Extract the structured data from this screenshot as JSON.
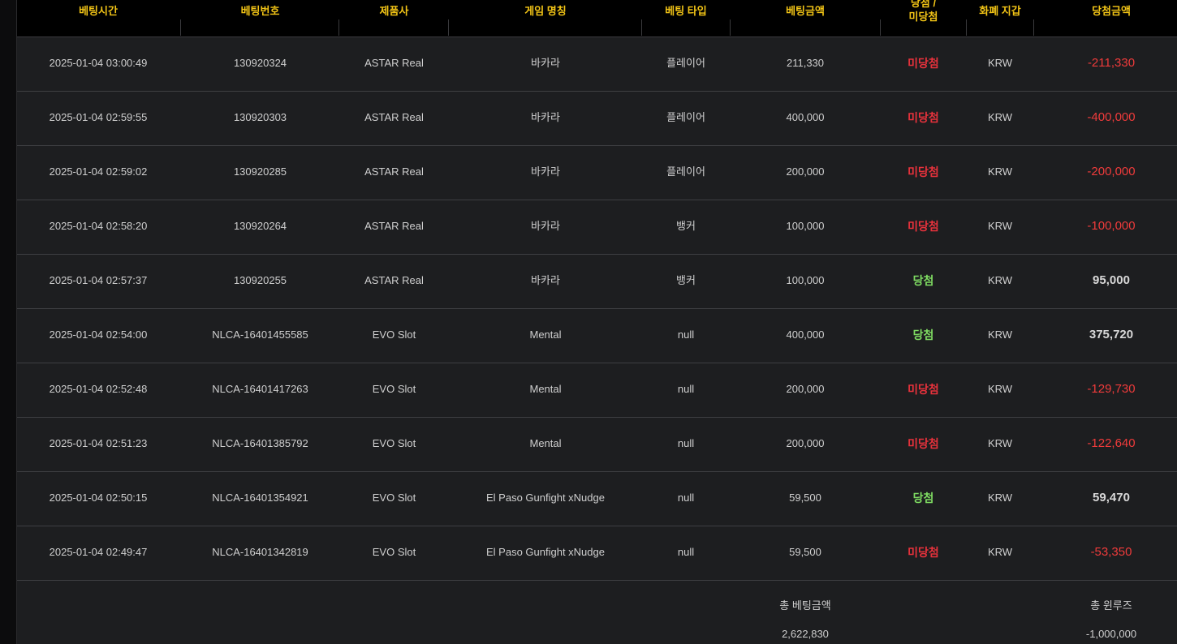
{
  "headers": {
    "bet_time": "베팅시간",
    "bet_no": "베팅번호",
    "vendor": "제품사",
    "game_name": "게임 명칭",
    "bet_type": "베팅 타입",
    "bet_amount": "베팅금액",
    "result_line1": "당첨 /",
    "result_line2": "미당첨",
    "currency": "화폐 지갑",
    "win_amount": "당첨금액"
  },
  "rows": [
    {
      "time": "2025-01-04 03:00:49",
      "bet_no": "130920324",
      "vendor": "ASTAR Real",
      "game": "바카라",
      "type": "플레이어",
      "amount": "211,330",
      "result": "미당첨",
      "currency": "KRW",
      "win_amount": "-211,330"
    },
    {
      "time": "2025-01-04 02:59:55",
      "bet_no": "130920303",
      "vendor": "ASTAR Real",
      "game": "바카라",
      "type": "플레이어",
      "amount": "400,000",
      "result": "미당첨",
      "currency": "KRW",
      "win_amount": "-400,000"
    },
    {
      "time": "2025-01-04 02:59:02",
      "bet_no": "130920285",
      "vendor": "ASTAR Real",
      "game": "바카라",
      "type": "플레이어",
      "amount": "200,000",
      "result": "미당첨",
      "currency": "KRW",
      "win_amount": "-200,000"
    },
    {
      "time": "2025-01-04 02:58:20",
      "bet_no": "130920264",
      "vendor": "ASTAR Real",
      "game": "바카라",
      "type": "뱅커",
      "amount": "100,000",
      "result": "미당첨",
      "currency": "KRW",
      "win_amount": "-100,000"
    },
    {
      "time": "2025-01-04 02:57:37",
      "bet_no": "130920255",
      "vendor": "ASTAR Real",
      "game": "바카라",
      "type": "뱅커",
      "amount": "100,000",
      "result": "당첨",
      "currency": "KRW",
      "win_amount": "95,000"
    },
    {
      "time": "2025-01-04 02:54:00",
      "bet_no": "NLCA-16401455585",
      "vendor": "EVO Slot",
      "game": "Mental",
      "type": "null",
      "amount": "400,000",
      "result": "당첨",
      "currency": "KRW",
      "win_amount": "375,720"
    },
    {
      "time": "2025-01-04 02:52:48",
      "bet_no": "NLCA-16401417263",
      "vendor": "EVO Slot",
      "game": "Mental",
      "type": "null",
      "amount": "200,000",
      "result": "미당첨",
      "currency": "KRW",
      "win_amount": "-129,730"
    },
    {
      "time": "2025-01-04 02:51:23",
      "bet_no": "NLCA-16401385792",
      "vendor": "EVO Slot",
      "game": "Mental",
      "type": "null",
      "amount": "200,000",
      "result": "미당첨",
      "currency": "KRW",
      "win_amount": "-122,640"
    },
    {
      "time": "2025-01-04 02:50:15",
      "bet_no": "NLCA-16401354921",
      "vendor": "EVO Slot",
      "game": "El Paso Gunfight xNudge",
      "type": "null",
      "amount": "59,500",
      "result": "당첨",
      "currency": "KRW",
      "win_amount": "59,470"
    },
    {
      "time": "2025-01-04 02:49:47",
      "bet_no": "NLCA-16401342819",
      "vendor": "EVO Slot",
      "game": "El Paso Gunfight xNudge",
      "type": "null",
      "amount": "59,500",
      "result": "미당첨",
      "currency": "KRW",
      "win_amount": "-53,350"
    }
  ],
  "summary": {
    "total_bet_label": "총 베팅금액",
    "total_bet_value": "2,622,830",
    "total_winloss_label": "총 윈루즈",
    "total_winloss_value": "-1,000,000"
  },
  "colors": {
    "header_text": "#f3c516",
    "lose": "#e8323c",
    "win": "#7fdc62",
    "negative_amount": "#ef3b3b",
    "background": "#1d1e20"
  }
}
